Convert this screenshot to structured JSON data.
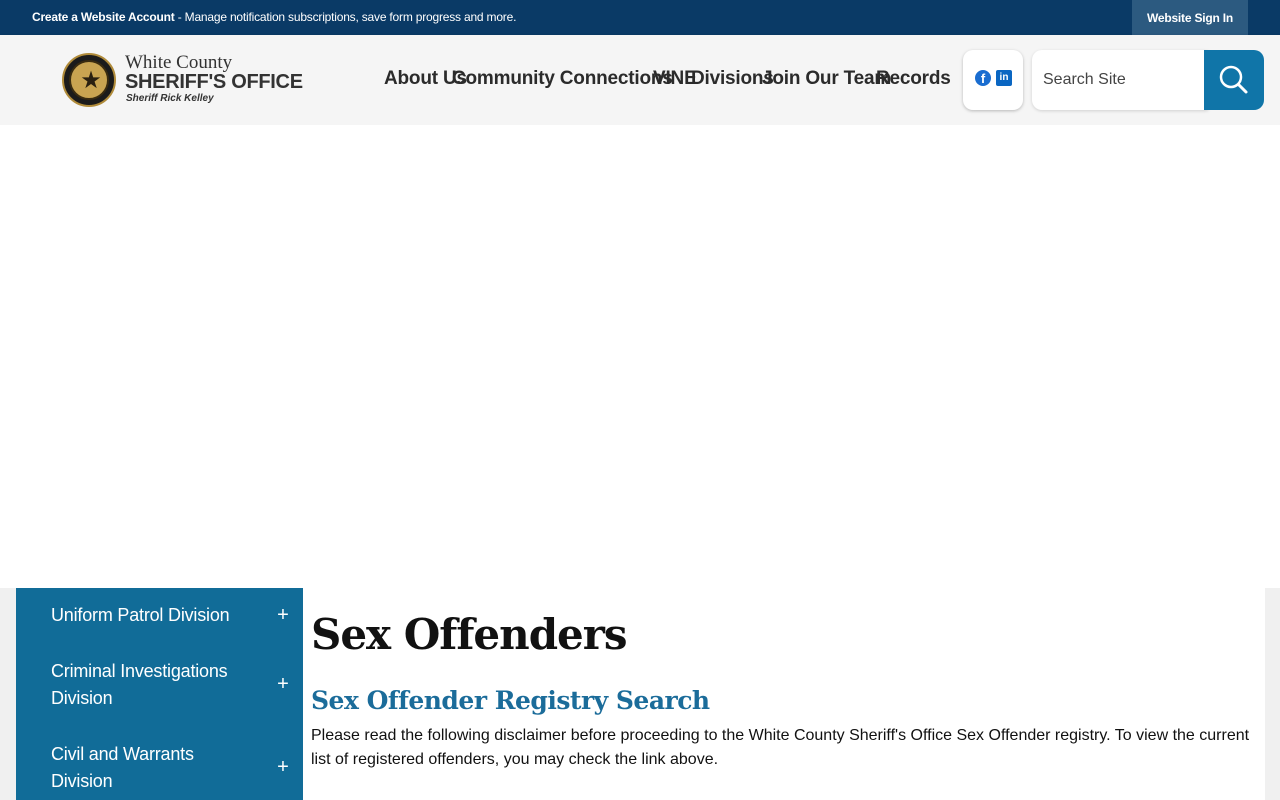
{
  "topbar": {
    "account_link": "Create a Website Account",
    "account_desc": " - Manage notification subscriptions, save form progress and more.",
    "signin": "Website Sign In"
  },
  "logo": {
    "line1": "White County",
    "line2": "SHERIFF'S OFFICE",
    "line3": "Sheriff Rick Kelley"
  },
  "nav": {
    "items": [
      "About Us",
      "Community Connections",
      "VINE",
      "Divisions",
      "Join Our Team",
      "Records"
    ]
  },
  "social": {
    "facebook_icon": "facebook-icon",
    "linkedin_icon": "linkedin-icon"
  },
  "search": {
    "placeholder": "Search Site",
    "icon": "search-icon"
  },
  "sidebar": {
    "items": [
      {
        "label": "Uniform Patrol Division",
        "toggle": "+"
      },
      {
        "label": "Criminal Investigations Division",
        "toggle": "+"
      },
      {
        "label": "Civil and Warrants Division",
        "toggle": "+"
      }
    ]
  },
  "main": {
    "title": "Sex Offenders",
    "subtitle": "Sex Offender Registry Search",
    "body": "Please read the following disclaimer before proceeding to the White County Sheriff's Office Sex Offender registry. To view the current list of registered offenders, you may check the link above."
  },
  "colors": {
    "topbar": "#0a3a66",
    "accent": "#1075a8",
    "sidebar": "#116c98",
    "subtitle": "#1b6c9a"
  }
}
